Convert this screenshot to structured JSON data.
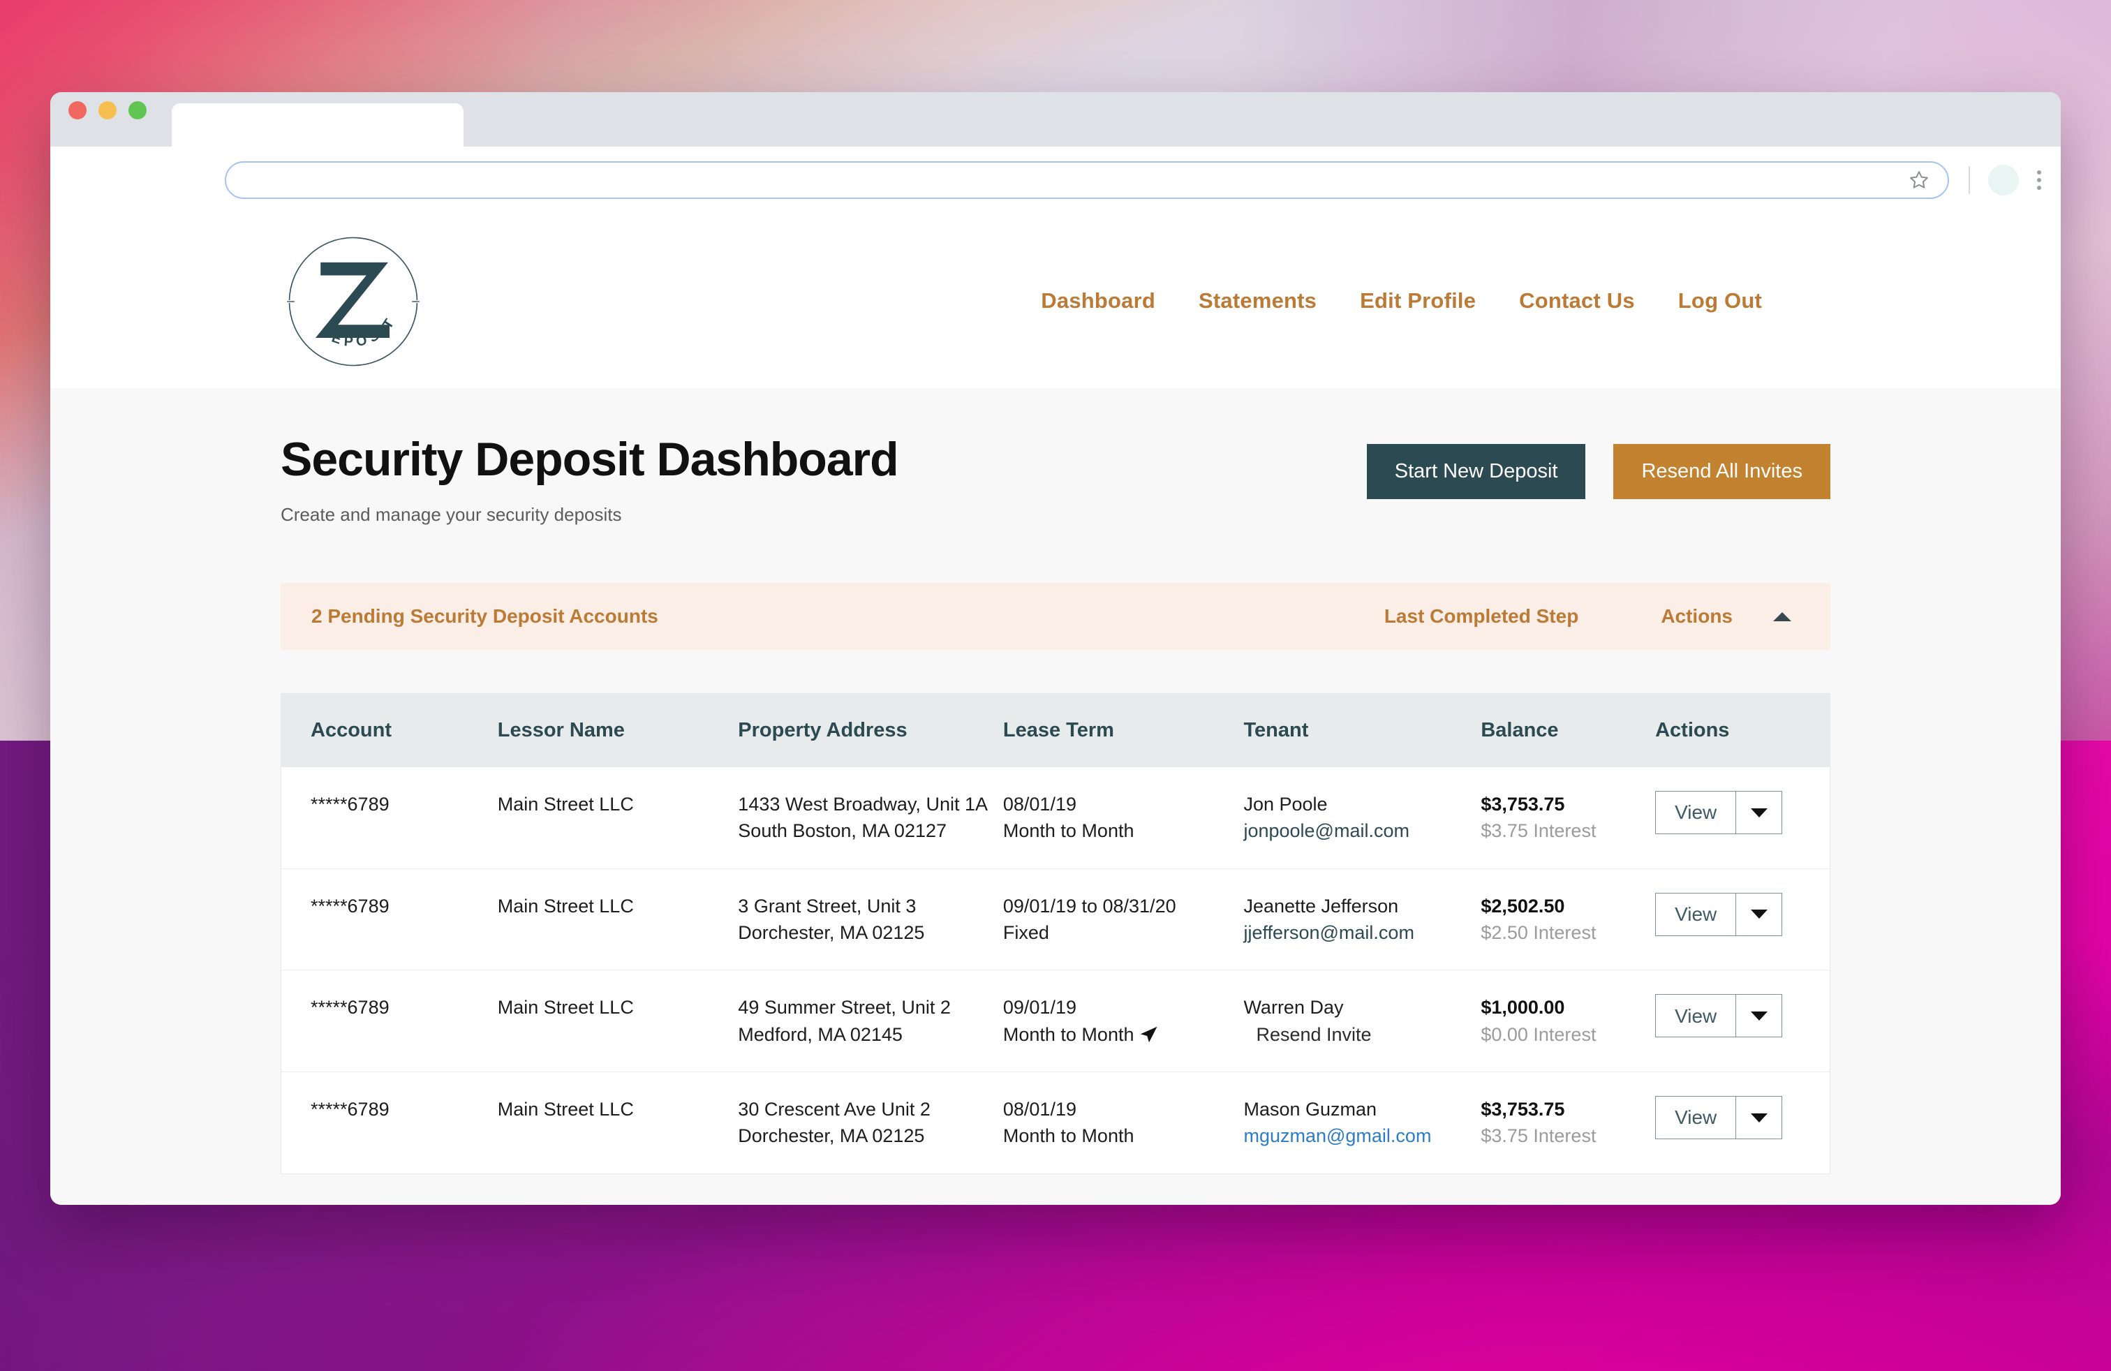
{
  "browser": {
    "traffic_lights": [
      "close-red",
      "minimize-yellow",
      "maximize-green"
    ],
    "tab_title": "",
    "url_value": "",
    "url_placeholder": "",
    "icons": [
      "bookmark-star-icon",
      "profile-avatar-icon",
      "browser-menu-kebab-icon"
    ]
  },
  "brand": {
    "monogram": "Z",
    "wordmark": "DEPOSIT"
  },
  "nav": {
    "items": [
      {
        "label": "Dashboard"
      },
      {
        "label": "Statements"
      },
      {
        "label": "Edit Profile"
      },
      {
        "label": "Contact Us"
      },
      {
        "label": "Log Out"
      }
    ],
    "link_color": "#bb7a36"
  },
  "page": {
    "title": "Security Deposit Dashboard",
    "subtitle": "Create and manage your security deposits",
    "primary_button": "Start New Deposit",
    "secondary_button": "Resend All Invites",
    "primary_button_color": "#2c4a52",
    "secondary_button_color": "#c3822f"
  },
  "pending_bar": {
    "title": "2 Pending Security Deposit Accounts",
    "last_completed_step": "Last Completed Step",
    "actions": "Actions",
    "collapse_state": "expanded",
    "background": "#faeee6",
    "text_color": "#bb7a36"
  },
  "table": {
    "headers": {
      "account": "Account",
      "lessor": "Lessor Name",
      "address": "Property Address",
      "lease": "Lease Term",
      "tenant": "Tenant",
      "balance": "Balance",
      "actions": "Actions"
    },
    "action_button": {
      "view": "View",
      "caret": "chevron-down-icon"
    },
    "rows": [
      {
        "account": "*****6789",
        "lessor": "Main Street LLC",
        "address_line1": "1433 West Broadway, Unit 1A",
        "address_line2": "South Boston, MA 02127",
        "lease_start": "08/01/19",
        "lease_type": "Month to Month",
        "tenant_name": "Jon Poole",
        "tenant_contact": "jonpoole@mail.com",
        "tenant_contact_style": "email",
        "balance": "$3,753.75",
        "interest": "$3.75 Interest",
        "has_cursor": false
      },
      {
        "account": "*****6789",
        "lessor": "Main Street LLC",
        "address_line1": "3 Grant Street, Unit 3",
        "address_line2": "Dorchester, MA 02125",
        "lease_start": "09/01/19 to 08/31/20",
        "lease_type": "Fixed",
        "tenant_name": "Jeanette Jefferson",
        "tenant_contact": "jjefferson@mail.com",
        "tenant_contact_style": "email",
        "balance": "$2,502.50",
        "interest": "$2.50 Interest",
        "has_cursor": false
      },
      {
        "account": "*****6789",
        "lessor": "Main Street LLC",
        "address_line1": "49 Summer Street, Unit 2",
        "address_line2": "Medford, MA 02145",
        "lease_start": "09/01/19",
        "lease_type": "Month to Month",
        "tenant_name": "Warren Day",
        "tenant_contact": "Resend Invite",
        "tenant_contact_style": "resend",
        "balance": "$1,000.00",
        "interest": "$0.00 Interest",
        "has_cursor": true
      },
      {
        "account": "*****6789",
        "lessor": "Main Street LLC",
        "address_line1": "30 Crescent Ave Unit 2",
        "address_line2": "Dorchester, MA 02125",
        "lease_start": "08/01/19",
        "lease_type": "Month to Month",
        "tenant_name": "Mason Guzman",
        "tenant_contact": "mguzman@gmail.com",
        "tenant_contact_style": "email-blue",
        "balance": "$3,753.75",
        "interest": "$3.75 Interest",
        "has_cursor": false
      }
    ]
  }
}
